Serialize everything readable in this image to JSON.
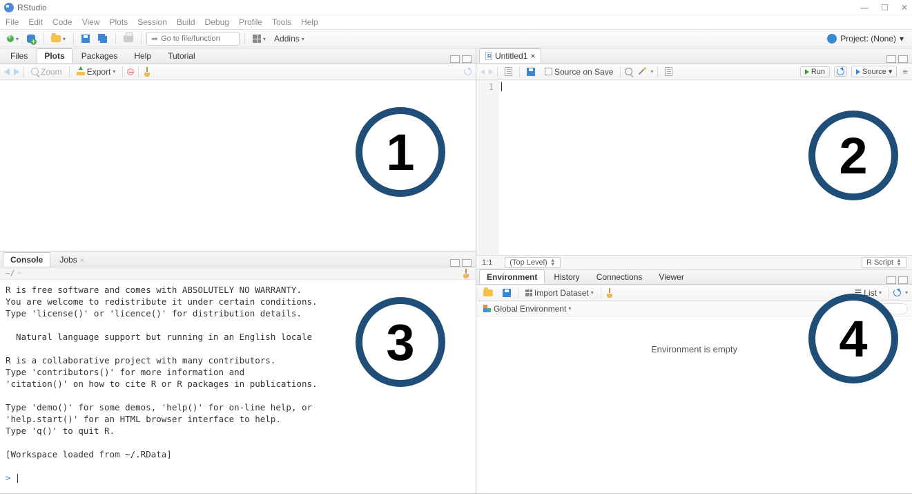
{
  "titlebar": {
    "title": "RStudio"
  },
  "menubar": [
    "File",
    "Edit",
    "Code",
    "View",
    "Plots",
    "Session",
    "Build",
    "Debug",
    "Profile",
    "Tools",
    "Help"
  ],
  "toolbar": {
    "goto_placeholder": "Go to file/function",
    "addins_label": "Addins",
    "project_label": "Project: (None)"
  },
  "panes": {
    "top_left": {
      "tabs": [
        "Files",
        "Plots",
        "Packages",
        "Help",
        "Tutorial"
      ],
      "active": "Plots",
      "subbar": {
        "zoom": "Zoom",
        "export": "Export"
      }
    },
    "bottom_left": {
      "tabs": [
        "Console",
        "Jobs"
      ],
      "active": "Console",
      "path": "~/",
      "text": "R is free software and comes with ABSOLUTELY NO WARRANTY.\nYou are welcome to redistribute it under certain conditions.\nType 'license()' or 'licence()' for distribution details.\n\n  Natural language support but running in an English locale\n\nR is a collaborative project with many contributors.\nType 'contributors()' for more information and\n'citation()' on how to cite R or R packages in publications.\n\nType 'demo()' for some demos, 'help()' for on-line help, or\n'help.start()' for an HTML browser interface to help.\nType 'q()' to quit R.\n\n[Workspace loaded from ~/.RData]\n",
      "prompt": ">"
    },
    "top_right": {
      "tabs": [
        "Untitled1"
      ],
      "active": "Untitled1",
      "subbar": {
        "source_on_save": "Source on Save",
        "run": "Run",
        "source": "Source"
      },
      "gutter": "1",
      "status": {
        "pos": "1:1",
        "level": "(Top Level)",
        "type": "R Script"
      }
    },
    "bottom_right": {
      "tabs": [
        "Environment",
        "History",
        "Connections",
        "Viewer"
      ],
      "active": "Environment",
      "subbar": {
        "import": "Import Dataset",
        "view": "List"
      },
      "scope": "Global Environment",
      "empty": "Environment is empty"
    }
  },
  "badges": {
    "b1": "1",
    "b2": "2",
    "b3": "3",
    "b4": "4"
  }
}
